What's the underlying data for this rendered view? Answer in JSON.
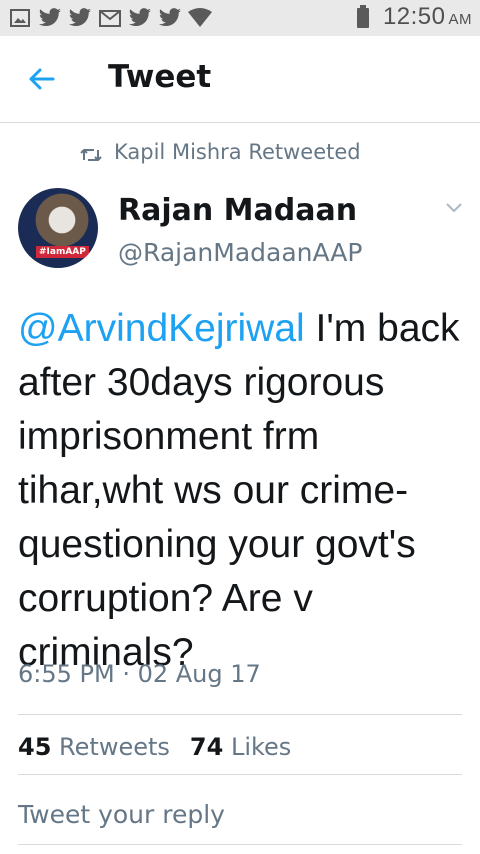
{
  "status_bar": {
    "icons": [
      "gallery-icon",
      "twitter-icon",
      "twitter-icon",
      "gmail-icon",
      "twitter-icon",
      "twitter-icon",
      "wifi-icon",
      "battery-icon"
    ],
    "time": "12:50",
    "ampm": "AM"
  },
  "header": {
    "title": "Tweet"
  },
  "retweet": {
    "text": "Kapil Mishra Retweeted"
  },
  "author": {
    "name": "Rajan Madaan",
    "handle": "@RajanMadaanAAP",
    "avatar_badge": "#IamAAP"
  },
  "tweet": {
    "mention": "@ArvindKejriwal",
    "text": " I'm back after 30days rigorous imprisonment frm tihar,wht ws our crime- questioning your govt's corruption? Are v criminals?"
  },
  "timestamp": "6:55 PM · 02 Aug 17",
  "stats": {
    "retweets_count": "45",
    "retweets_label": "Retweets",
    "likes_count": "74",
    "likes_label": "Likes"
  },
  "reply": {
    "placeholder": "Tweet your reply"
  },
  "colors": {
    "accent": "#1da1f2",
    "secondary_text": "#657786",
    "divider": "#d7dbdf"
  }
}
